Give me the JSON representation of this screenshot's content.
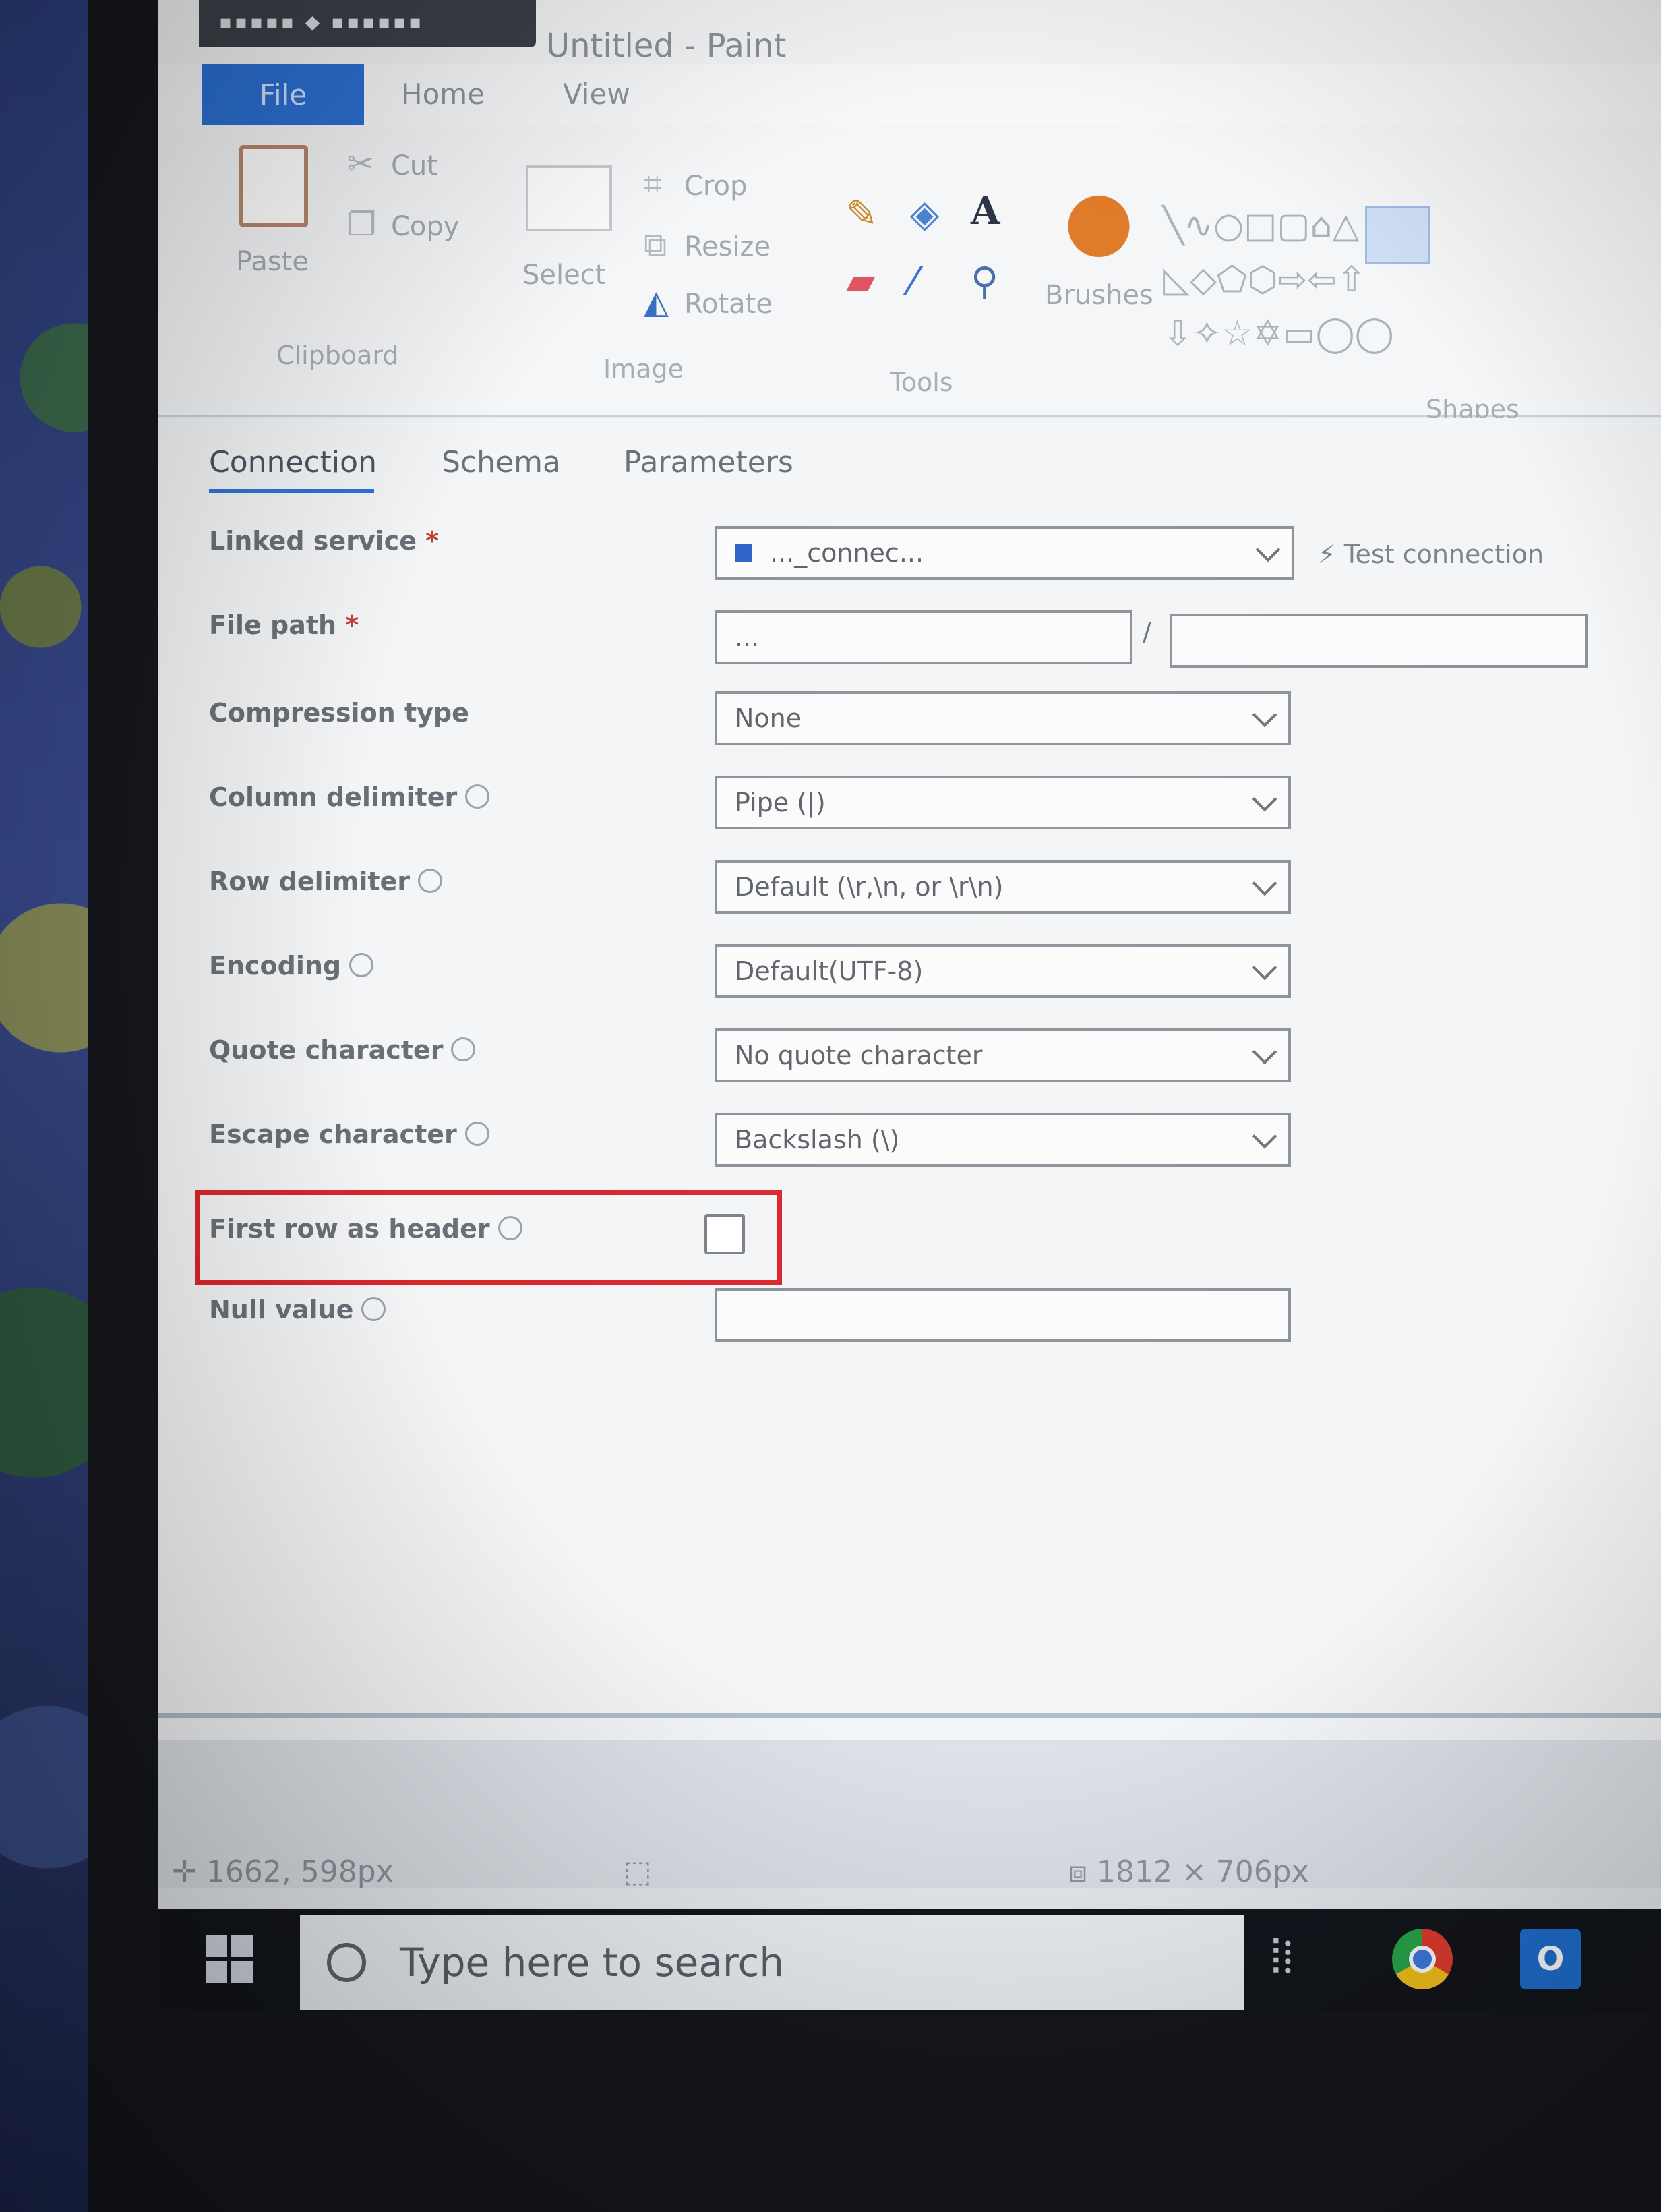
{
  "window": {
    "title": "Untitled - Paint"
  },
  "ribbon": {
    "tabs": [
      "File",
      "Home",
      "View"
    ],
    "clipboard": {
      "paste": "Paste",
      "cut": "Cut",
      "copy": "Copy",
      "label": "Clipboard"
    },
    "image": {
      "select": "Select",
      "crop": "Crop",
      "resize": "Resize",
      "rotate": "Rotate",
      "label": "Image"
    },
    "tools": {
      "label": "Tools",
      "text_tool": "A"
    },
    "brushes": {
      "label": "Brushes"
    },
    "shapes": {
      "label": "Shapes"
    }
  },
  "panel": {
    "tabs": [
      "Connection",
      "Schema",
      "Parameters"
    ],
    "fields": {
      "linked_service": {
        "label": "Linked service",
        "required": "*",
        "value": "..._connec..."
      },
      "file_path": {
        "label": "File path",
        "required": "*",
        "value": "...",
        "separator": "/"
      },
      "compression_type": {
        "label": "Compression type",
        "value": "None"
      },
      "column_delimiter": {
        "label": "Column delimiter",
        "value": "Pipe (|)"
      },
      "row_delimiter": {
        "label": "Row delimiter",
        "value": "Default (\\r,\\n, or \\r\\n)"
      },
      "encoding": {
        "label": "Encoding",
        "value": "Default(UTF-8)"
      },
      "quote_character": {
        "label": "Quote character",
        "value": "No quote character"
      },
      "escape_character": {
        "label": "Escape character",
        "value": "Backslash (\\)"
      },
      "first_row_as_header": {
        "label": "First row as header",
        "checked": false
      },
      "null_value": {
        "label": "Null value",
        "value": ""
      }
    },
    "test_connection": "Test connection"
  },
  "statusbar": {
    "cursor_pos": "1662, 598px",
    "image_size": "1812 × 706px"
  },
  "taskbar": {
    "search_placeholder": "Type here to search",
    "apps": [
      "chrome-icon",
      "outlook-icon"
    ]
  },
  "colors": {
    "accent": "#2c6fd1",
    "highlight": "#d9262b"
  }
}
